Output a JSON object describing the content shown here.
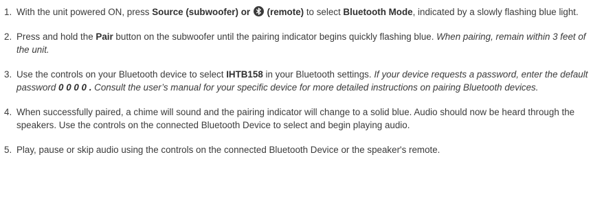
{
  "steps": [
    {
      "num": "1.",
      "parts": [
        {
          "t": "With the unit powered ON, press ",
          "s": "normal"
        },
        {
          "t": "Source (subwoofer) or ",
          "s": "bold"
        },
        {
          "icon": "bluetooth-icon"
        },
        {
          "t": " (remote)",
          "s": "bold"
        },
        {
          "t": " to select ",
          "s": "normal"
        },
        {
          "t": "Bluetooth Mode",
          "s": "bold"
        },
        {
          "t": ", indicated by a slowly flashing blue light.",
          "s": "normal"
        }
      ]
    },
    {
      "num": "2.",
      "parts": [
        {
          "t": "Press and hold the ",
          "s": "normal"
        },
        {
          "t": "Pair",
          "s": "bold"
        },
        {
          "t": " button on the subwoofer until the pairing indicator begins quickly flashing blue. ",
          "s": "normal"
        },
        {
          "t": "When pairing, remain within 3 feet of the unit.",
          "s": "italic"
        }
      ]
    },
    {
      "num": "3.",
      "parts": [
        {
          "t": "Use the controls on your Bluetooth device to select ",
          "s": "normal"
        },
        {
          "t": "IHTB158",
          "s": "bold"
        },
        {
          "t": " in your Bluetooth settings. ",
          "s": "normal"
        },
        {
          "t": "If your device requests a password, enter the default password ",
          "s": "italic"
        },
        {
          "t": "0 0 0 0 .",
          "s": "bolditalic"
        },
        {
          "t": " Consult the user’s manual for your specific device for more detailed instructions on pairing Bluetooth devices.",
          "s": "italic"
        }
      ]
    },
    {
      "num": "4.",
      "parts": [
        {
          "t": "When successfully paired, a chime will sound and the pairing indicator will change to a solid blue. Audio should now be heard through the speakers. Use the controls on the connected Bluetooth Device to select and begin playing audio.",
          "s": "normal"
        }
      ]
    },
    {
      "num": "5.",
      "parts": [
        {
          "t": "Play, pause or skip audio using the controls on the connected Bluetooth Device or the speaker's remote.",
          "s": "normal"
        }
      ]
    }
  ]
}
